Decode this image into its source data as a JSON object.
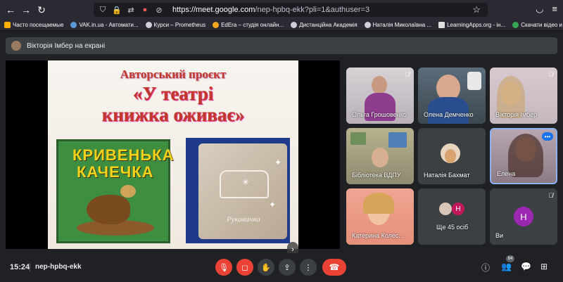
{
  "browser": {
    "url_host": "https://meet.google.com",
    "url_path": "/nep-hpbq-ekk?pli=1&authuser=3",
    "bookmarks": [
      "Часто посещаемые",
      "VAK.in.ua - Автомати...",
      "Курси – Prometheus",
      "EdEra – студія онлайн...",
      "Дистанційна Академія",
      "Наталія Миколаївна ...",
      "LearningApps.org - ін...",
      "Скачати відео и музи..."
    ]
  },
  "presenting": {
    "label": "Вікторія Імбер на екрані"
  },
  "slide": {
    "line1": "Авторський проєкт",
    "line2": "«У театрі",
    "line3": "книжка оживає»",
    "book1_line1": "КРИВЕНЬКА",
    "book1_line2": "КАЧЕЧКА",
    "book2_sig": "Рукавичка"
  },
  "participants": [
    {
      "name": "Ольга Грошовенко"
    },
    {
      "name": "Олена Демченко"
    },
    {
      "name": "Вікторія Імбер"
    },
    {
      "name": "Бібліотека ВДПУ"
    },
    {
      "name": "Наталія Бахмат"
    },
    {
      "name": "Елена"
    },
    {
      "name": "Катерина Колес..."
    },
    {
      "name": "Ще 45 осіб"
    },
    {
      "name": "Ви",
      "initial": "H"
    }
  ],
  "bottom": {
    "time": "15:24",
    "meeting_code": "nep-hpbq-ekk",
    "people_count": "64"
  }
}
